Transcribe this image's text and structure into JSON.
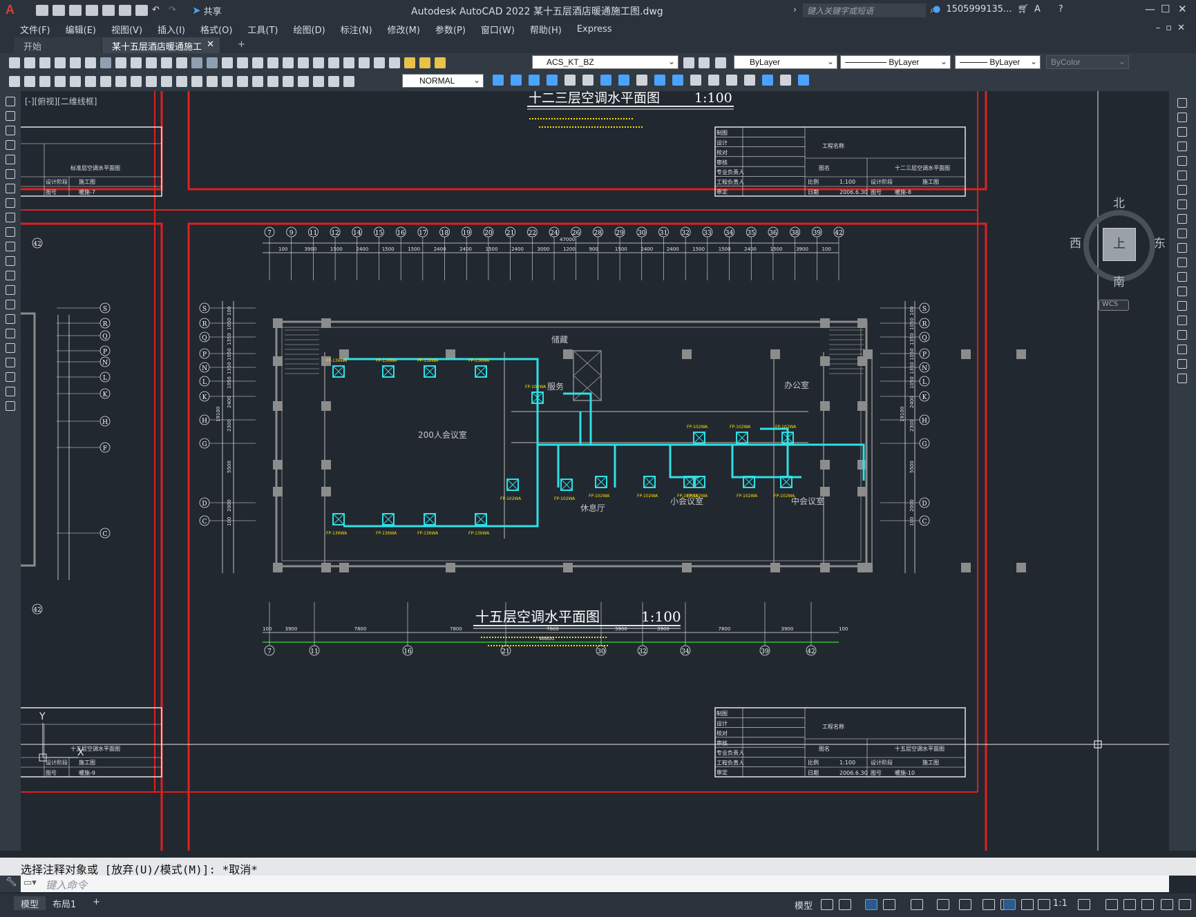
{
  "app": {
    "logo": "A",
    "title": "Autodesk AutoCAD 2022    某十五层酒店暖通施工图.dwg",
    "share_label": "共享",
    "search_placeholder": "键入关键字或短语",
    "user": "1505999135...",
    "window_controls": [
      "—",
      "☐",
      "✕"
    ]
  },
  "menu": [
    "文件(F)",
    "编辑(E)",
    "视图(V)",
    "插入(I)",
    "格式(O)",
    "工具(T)",
    "绘图(D)",
    "标注(N)",
    "修改(M)",
    "参数(P)",
    "窗口(W)",
    "帮助(H)",
    "Express"
  ],
  "tabs": {
    "start": "开始",
    "doc": "某十五层酒店暖通施工图*",
    "close": "✕",
    "add": "+"
  },
  "toolbar": {
    "layer": "ACS_KT_BZ",
    "color": "ByLayer",
    "linetype": "ByLayer",
    "lineweight": "ByLayer",
    "plotstyle": "ByColor",
    "dimstyle": "NORMAL"
  },
  "viewport_label": "[-][俯视][二维线框]",
  "viewcube": {
    "north": "北",
    "south": "南",
    "east": "东",
    "west": "西",
    "top": "上",
    "wcs": "WCS"
  },
  "drawing": {
    "title_upper": "十二三层空调水平面图",
    "title_main": "十五层空调水平面图",
    "scale": "1:100",
    "rooms": [
      "200人会议室",
      "储藏",
      "服务",
      "休息厅",
      "小会议室",
      "中会议室",
      "办公室"
    ],
    "fcu_labels": [
      "FP-136WA",
      "FP-136WA",
      "FP-136WA",
      "FP-136WA",
      "FP-136WA",
      "FP-136WA",
      "FP-136WA",
      "FP-136WA",
      "FP-102WA",
      "FP-102WA",
      "FP-102WA",
      "FP-102WA",
      "FP-102WA",
      "FP-102WA",
      "FP-102WA",
      "FP-102WA",
      "FP-102WA",
      "FP-102WA",
      "FP-102WA",
      "FP-102WA"
    ],
    "top_axes": [
      "7",
      "9",
      "11",
      "12",
      "14",
      "15",
      "16",
      "17",
      "18",
      "19",
      "20",
      "21",
      "22",
      "24",
      "26",
      "28",
      "29",
      "30",
      "31",
      "32",
      "33",
      "34",
      "35",
      "36",
      "38",
      "39",
      "42"
    ],
    "top_dims": [
      "100",
      "3900",
      "1500",
      "2400",
      "1500",
      "1500",
      "2400",
      "2400",
      "1500",
      "2400",
      "3000",
      "1200",
      "900",
      "1500",
      "2400",
      "2400",
      "1500",
      "1500",
      "2400",
      "1500",
      "3900",
      "100"
    ],
    "top_total": "47000",
    "bottom_axes": [
      "7",
      "11",
      "16",
      "21",
      "30",
      "32",
      "34",
      "39",
      "42"
    ],
    "bottom_dims": [
      "100",
      "3900",
      "7800",
      "7800",
      "7800",
      "3900",
      "3900",
      "7800",
      "3900",
      "100"
    ],
    "bottom_total": "46800",
    "side_axes": [
      "S",
      "R",
      "Q",
      "P",
      "N",
      "L",
      "K",
      "H",
      "G",
      "D",
      "C"
    ],
    "side_total": "19100",
    "side_dims": [
      "100",
      "1050",
      "1350",
      "1050",
      "1350",
      "1050",
      "2400",
      "2300",
      "5500",
      "2000",
      "100"
    ],
    "title_block": {
      "rows": [
        "制图",
        "设计",
        "校对",
        "审核",
        "专业负责人",
        "工程负责人",
        "审定"
      ],
      "project": "工程名称",
      "drawing_name_label": "图名",
      "drawing_name_upper": "十二三层空调水平面图",
      "drawing_name_main": "十五层空调水平面图",
      "scale_label": "比例",
      "scale": "1:100",
      "date_label": "日期",
      "date": "2006.6.30",
      "stage_label": "设计阶段",
      "stage": "施工图",
      "sheet_label": "图号",
      "sheet_upper": "暖施-8",
      "sheet_main": "暖施-10",
      "sheet_left_upper": "暖施-7",
      "sheet_left_main": "暖施-9",
      "left_name_upper": "标准层空调水平面图",
      "left_name_main": "十五层空调水平面图"
    },
    "ucs": {
      "y": "Y",
      "x": "X"
    }
  },
  "command": {
    "history": "选择注释对象或 [放弃(U)/模式(M)]: *取消*",
    "placeholder": "键入命令"
  },
  "status": {
    "tabs": [
      "模型",
      "布局1",
      "+"
    ],
    "model_button": "模型",
    "scale": "1:1"
  }
}
